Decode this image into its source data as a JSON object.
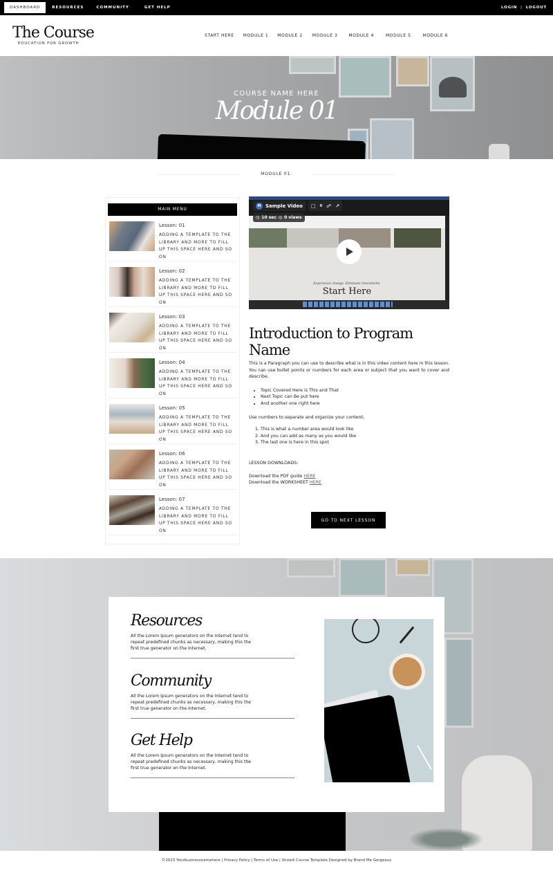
{
  "topbar": {
    "links": [
      {
        "label": "DASHBOARD",
        "active": true
      },
      {
        "label": "RESOURCES",
        "active": false
      },
      {
        "label": "COMMUNITY",
        "active": false
      },
      {
        "label": "GET HELP",
        "active": false
      }
    ],
    "login": "LOGIN",
    "separator": "|",
    "logout": "LOGOUT"
  },
  "header": {
    "logo": "The Course",
    "tagline": "EDUCATION FOR GROWTH",
    "nav": [
      "START HERE",
      "MODULE 1",
      "MODULE 2",
      "MODULE 3",
      "MODULE 4",
      "MODULE 5",
      "MODULE 6"
    ]
  },
  "hero": {
    "subtitle": "COURSE NAME HERE",
    "title": "Module 01"
  },
  "section_label": "MODULE 01.",
  "sidebar": {
    "heading": "MAIN MENU",
    "lessons": [
      {
        "title": "Lesson: 01",
        "desc": "ADDING A TEMPLATE TO THE LIBRARY AND MORE TO FILL UP THIS SPACE HERE AND SO ON"
      },
      {
        "title": "Lesson: 02",
        "desc": "ADDING A TEMPLATE TO THE LIBRARY AND MORE TO FILL UP THIS SPACE HERE AND SO ON"
      },
      {
        "title": "Lesson: 03",
        "desc": "ADDING A TEMPLATE TO THE LIBRARY AND MORE TO FILL UP THIS SPACE HERE AND SO ON"
      },
      {
        "title": "Lesson: 04",
        "desc": "ADDING A TEMPLATE TO THE LIBRARY AND MORE TO FILL UP THIS SPACE HERE AND SO ON"
      },
      {
        "title": "Lesson: 05",
        "desc": "ADDING A TEMPLATE TO THE LIBRARY AND MORE TO FILL UP THIS SPACE HERE AND SO ON"
      },
      {
        "title": "Lesson: 06",
        "desc": "ADDING A TEMPLATE TO THE LIBRARY AND MORE TO FILL UP THIS SPACE HERE AND SO ON"
      },
      {
        "title": "Lesson: 07",
        "desc": "ADDING A TEMPLATE TO THE LIBRARY AND MORE TO FILL UP THIS SPACE HERE AND SO ON"
      }
    ]
  },
  "video": {
    "avatar_letter": "M",
    "title": "Sample Video",
    "comments": "0",
    "duration": "10 sec",
    "views": "0 views",
    "preview_subtitle": "Experience change. Eliminate Overwhelm.",
    "preview_title": "Start Here"
  },
  "lesson": {
    "title": "Introduction to Program Name",
    "intro": "This is a Paragraph you can use to describe what is in this video content here in this lesson. You can use bullet points or numbers for each area or subject that you want to cover and describe.",
    "bullets": [
      "Topic Covered Here is This and That",
      "Next Topic can Be put here",
      "And another one right here"
    ],
    "numbers_intro": "Use numbers to separate and organize your content;",
    "numbered": [
      "This is what a number area would look like",
      "And you can add as many as you would like",
      "The last one is here in this spot"
    ],
    "downloads_heading": "LESSON DOWNLOADS:",
    "downloads": [
      {
        "text": "Download the PDF guide ",
        "link": "HERE"
      },
      {
        "text": "Download the WORKSHEET ",
        "link": "HERE"
      }
    ],
    "next_button": "GO TO NEXT LESSON"
  },
  "resources": [
    {
      "title": "Resources",
      "text": "All the Lorem Ipsum generators on the Internet tend to repeat predefined chunks as necessary, making this the first true generator on the Internet."
    },
    {
      "title": "Community",
      "text": "All the Lorem Ipsum generators on the Internet tend to repeat predefined chunks as necessary, making this the first true generator on the Internet."
    },
    {
      "title": "Get Help",
      "text": "All the Lorem Ipsum generators on the Internet tend to repeat predefined chunks as necessary, making this the first true generator on the Internet."
    }
  ],
  "footer": {
    "copyright": "©2023 Yourbusinessnamehere",
    "privacy": "Privacy Policy",
    "terms": "Terms of Use",
    "credit": "Showit Course Template Designed by Brand Me Gorgeous",
    "sep": " | "
  }
}
